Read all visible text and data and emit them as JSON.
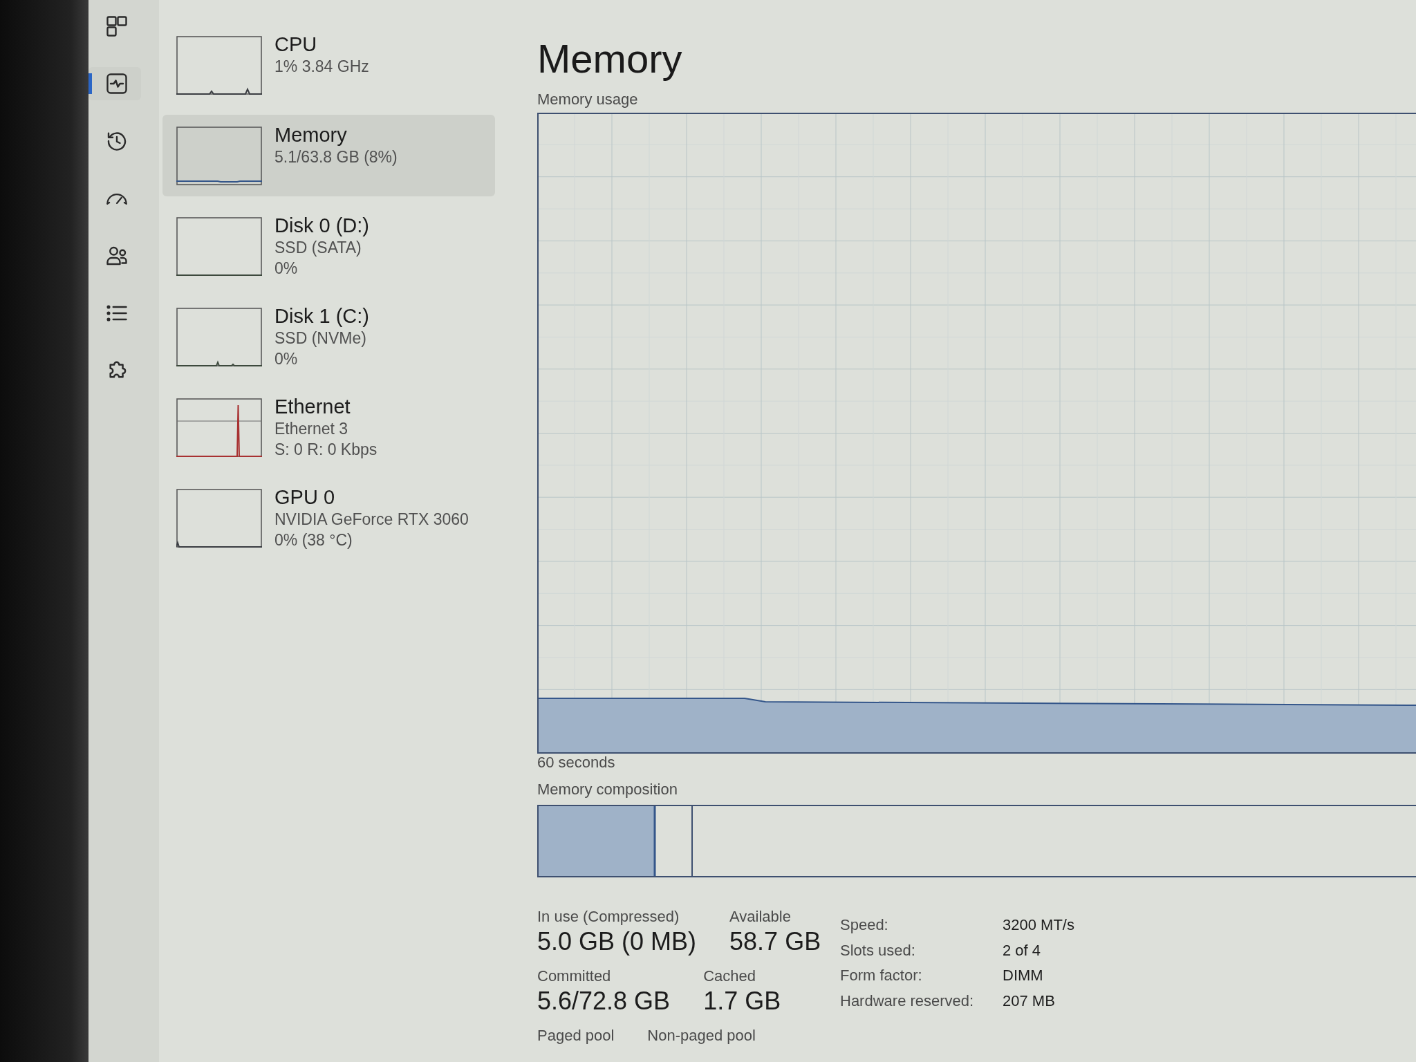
{
  "nav": [
    {
      "selected": false
    },
    {
      "selected": true
    },
    {
      "selected": false
    },
    {
      "selected": false
    },
    {
      "selected": false
    },
    {
      "selected": false
    },
    {
      "selected": false
    }
  ],
  "resources": [
    {
      "name": "CPU",
      "details": [
        "1% 3.84 GHz"
      ],
      "color": "#3a3d42",
      "selected": false
    },
    {
      "name": "Memory",
      "details": [
        "5.1/63.8 GB (8%)"
      ],
      "color": "#34568a",
      "selected": true
    },
    {
      "name": "Disk 0 (D:)",
      "details": [
        "SSD (SATA)",
        "0%"
      ],
      "color": "#3d4a3d",
      "selected": false
    },
    {
      "name": "Disk 1 (C:)",
      "details": [
        "SSD (NVMe)",
        "0%"
      ],
      "color": "#3d4a3d",
      "selected": false
    },
    {
      "name": "Ethernet",
      "details": [
        "Ethernet 3",
        "S: 0 R: 0 Kbps"
      ],
      "color": "#a83232",
      "selected": false
    },
    {
      "name": "GPU 0",
      "details": [
        "NVIDIA GeForce RTX 3060",
        "0% (38 °C)"
      ],
      "color": "#3a3d42",
      "selected": false
    }
  ],
  "detail": {
    "title": "Memory",
    "usage_chart": {
      "label": "Memory usage",
      "time_label": "60 seconds"
    },
    "composition": {
      "label": "Memory composition"
    },
    "stats": [
      {
        "label": "In use (Compressed)",
        "value": "5.0 GB (0 MB)"
      },
      {
        "label": "Available",
        "value": "58.7 GB"
      },
      {
        "label": "Committed",
        "value": "5.6/72.8 GB"
      },
      {
        "label": "Cached",
        "value": "1.7 GB"
      },
      {
        "label": "Paged pool"
      },
      {
        "label": "Non-paged pool"
      }
    ],
    "properties": [
      {
        "label": "Speed:",
        "value": "3200 MT/s"
      },
      {
        "label": "Slots used:",
        "value": "2 of 4"
      },
      {
        "label": "Form factor:",
        "value": "DIMM"
      },
      {
        "label": "Hardware reserved:",
        "value": "207 MB"
      }
    ]
  }
}
